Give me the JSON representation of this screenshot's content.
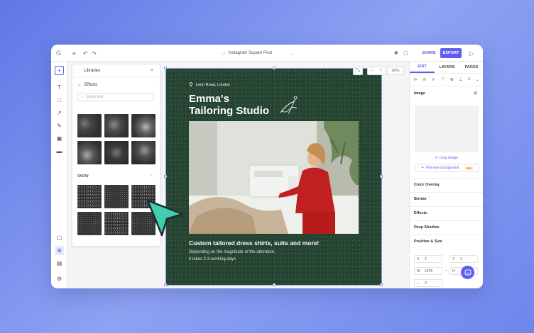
{
  "topbar": {
    "doc_title": "Instagram Square Post",
    "share_label": "SHARE",
    "export_label": "EXPORT"
  },
  "libraries": {
    "title": "Libraries",
    "back_label": "Effects",
    "search_placeholder": "Quick find",
    "section_snow": "SNOW"
  },
  "zoom": {
    "value": "68%"
  },
  "design": {
    "location": "Leon Road, London",
    "title_line1": "Emma's",
    "title_line2": "Tailoring Studio",
    "headline": "Custom tailored dress shirts, suits and more!",
    "body_line1": "Depending on the magnitude of the alteration,",
    "body_line2": "it takes 2-3 working days",
    "bg_color": "#244331"
  },
  "right_panel": {
    "tabs": [
      "EDIT",
      "LAYERS",
      "PAGES"
    ],
    "image_label": "Image",
    "crop_label": "Crop image",
    "remove_bg_label": "Remove background",
    "remove_bg_badge": "5/6",
    "sections": [
      "Color Overlay",
      "Border",
      "Effects",
      "Drop Shadow",
      "Position & Size"
    ],
    "x_label": "X",
    "x_value": "2",
    "y_label": "Y",
    "y_value": "1",
    "w_label": "W",
    "w_value": "1075",
    "h_label": "H",
    "r_label": "∟",
    "r_value": "0"
  },
  "colors": {
    "accent": "#5e5ff0",
    "canvas_green": "#244331",
    "cursor": "#3ecfb0"
  }
}
